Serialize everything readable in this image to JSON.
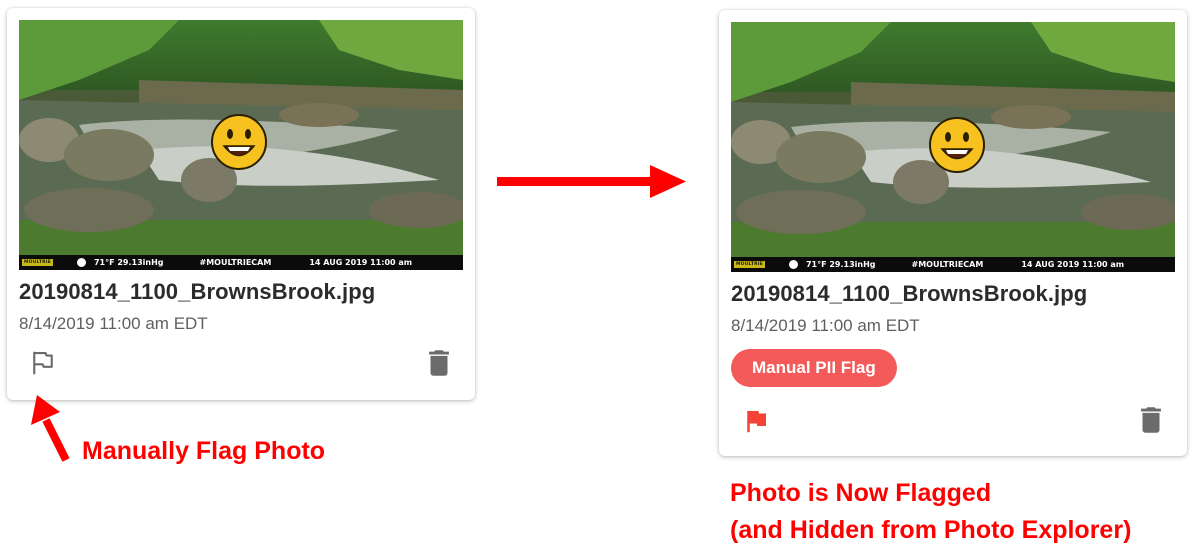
{
  "before_card": {
    "photo_overlay": {
      "brand": "MOULTRIE",
      "weather": "71°F  29.13inHg",
      "hashtag": "#MOULTRIECAM",
      "timestamp": "14 AUG 2019  11:00 am"
    },
    "filename": "20190814_1100_BrownsBrook.jpg",
    "datetime": "8/14/2019 11:00 am EDT",
    "flag_icon": "flag-outline-icon",
    "delete_icon": "trash-icon"
  },
  "after_card": {
    "photo_overlay": {
      "brand": "MOULTRIE",
      "weather": "71°F  29.13inHg",
      "hashtag": "#MOULTRIECAM",
      "timestamp": "14 AUG 2019  11:00 am"
    },
    "filename": "20190814_1100_BrownsBrook.jpg",
    "datetime": "8/14/2019 11:00 am EDT",
    "chip_label": "Manual PII Flag",
    "flag_icon": "flag-filled-icon",
    "delete_icon": "trash-icon"
  },
  "annotations": {
    "left": "Manually Flag Photo",
    "right_line1": "Photo is Now Flagged",
    "right_line2": "(and Hidden from Photo Explorer)"
  },
  "colors": {
    "annotation": "#ff0000",
    "chip": "#f45a5a",
    "flag_active": "#f44336",
    "icon_gray": "#6b6b6b"
  }
}
